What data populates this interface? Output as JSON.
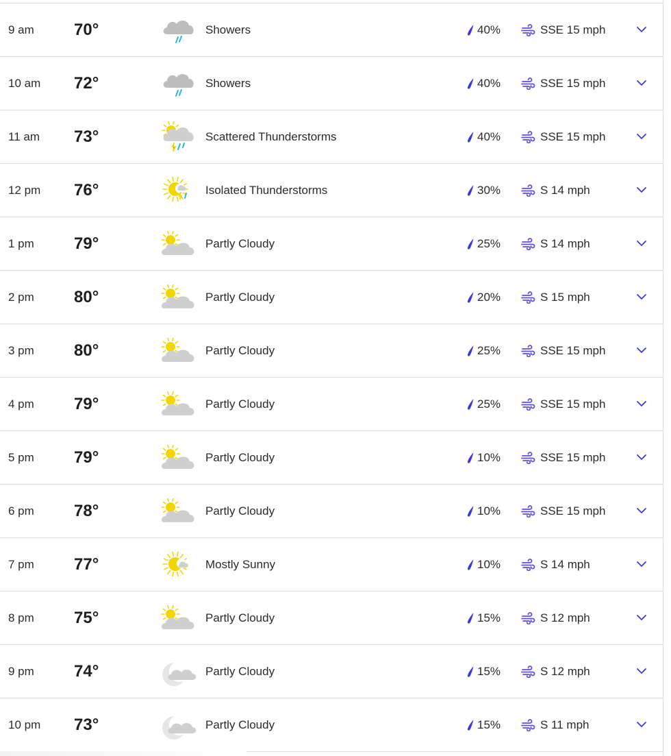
{
  "colors": {
    "accent": "#3b37e6",
    "wind_icon": "#5b4fe0",
    "cloud": "#cfcfcf",
    "sun": "#f2d600",
    "rain": "#27b6e6",
    "divider": "#dcdcdc"
  },
  "hourly": [
    {
      "time": "9 am",
      "temp": "70°",
      "icon": "showers-icon",
      "condition": "Showers",
      "precip": "40%",
      "wind": "SSE 15 mph"
    },
    {
      "time": "10 am",
      "temp": "72°",
      "icon": "showers-icon",
      "condition": "Showers",
      "precip": "40%",
      "wind": "SSE 15 mph"
    },
    {
      "time": "11 am",
      "temp": "73°",
      "icon": "scattered-thunderstorms-icon",
      "condition": "Scattered Thunderstorms",
      "precip": "40%",
      "wind": "SSE 15 mph"
    },
    {
      "time": "12 pm",
      "temp": "76°",
      "icon": "isolated-thunderstorms-icon",
      "condition": "Isolated Thunderstorms",
      "precip": "30%",
      "wind": "S 14 mph"
    },
    {
      "time": "1 pm",
      "temp": "79°",
      "icon": "partly-cloudy-day-icon",
      "condition": "Partly Cloudy",
      "precip": "25%",
      "wind": "S 14 mph"
    },
    {
      "time": "2 pm",
      "temp": "80°",
      "icon": "partly-cloudy-day-icon",
      "condition": "Partly Cloudy",
      "precip": "20%",
      "wind": "S 15 mph"
    },
    {
      "time": "3 pm",
      "temp": "80°",
      "icon": "partly-cloudy-day-icon",
      "condition": "Partly Cloudy",
      "precip": "25%",
      "wind": "SSE 15 mph"
    },
    {
      "time": "4 pm",
      "temp": "79°",
      "icon": "partly-cloudy-day-icon",
      "condition": "Partly Cloudy",
      "precip": "25%",
      "wind": "SSE 15 mph"
    },
    {
      "time": "5 pm",
      "temp": "79°",
      "icon": "partly-cloudy-day-icon",
      "condition": "Partly Cloudy",
      "precip": "10%",
      "wind": "SSE 15 mph"
    },
    {
      "time": "6 pm",
      "temp": "78°",
      "icon": "partly-cloudy-day-icon",
      "condition": "Partly Cloudy",
      "precip": "10%",
      "wind": "SSE 15 mph"
    },
    {
      "time": "7 pm",
      "temp": "77°",
      "icon": "mostly-sunny-icon",
      "condition": "Mostly Sunny",
      "precip": "10%",
      "wind": "S 14 mph"
    },
    {
      "time": "8 pm",
      "temp": "75°",
      "icon": "partly-cloudy-day-icon",
      "condition": "Partly Cloudy",
      "precip": "15%",
      "wind": "S 12 mph"
    },
    {
      "time": "9 pm",
      "temp": "74°",
      "icon": "partly-cloudy-night-icon",
      "condition": "Partly Cloudy",
      "precip": "15%",
      "wind": "S 12 mph"
    },
    {
      "time": "10 pm",
      "temp": "73°",
      "icon": "partly-cloudy-night-icon",
      "condition": "Partly Cloudy",
      "precip": "15%",
      "wind": "S 11 mph"
    }
  ]
}
